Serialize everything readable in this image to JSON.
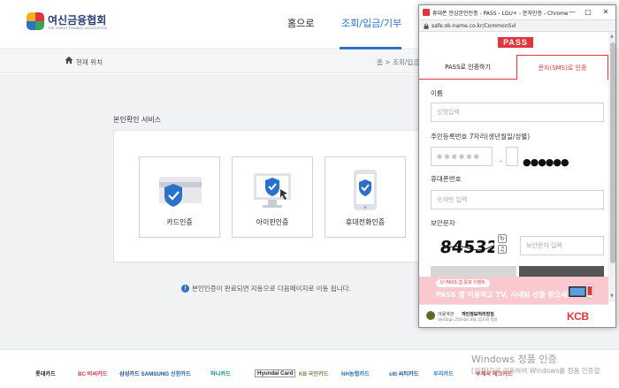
{
  "header": {
    "logo_title": "여신금융협회",
    "logo_subtitle": "THE CREDIT FINANCE ASSOCIATION",
    "nav": [
      "홈으로",
      "조회/입금/기부"
    ]
  },
  "breadcrumb": {
    "current_label": "현재 위치",
    "path": "홈 > 조회/입금"
  },
  "main": {
    "section_title": "본인확인 서비스",
    "cards": [
      {
        "label": "카드인증"
      },
      {
        "label": "아이핀인증"
      },
      {
        "label": "휴대전화인증"
      }
    ],
    "notice_icon": "!",
    "notice": "본인인증이 완료되면 자동으로 다음페이지로 이동 됩니다."
  },
  "footer": {
    "logos": [
      {
        "text": "롯데카드",
        "color": "#222222"
      },
      {
        "text": "BC 비씨카드",
        "color": "#e0353f"
      },
      {
        "text": "삼성카드 SAMSUNG",
        "color": "#1a4ea1"
      },
      {
        "text": "신한카드",
        "color": "#1f5fb3"
      },
      {
        "text": "하나카드",
        "color": "#009689"
      },
      {
        "text": "Hyundai Card",
        "color": "#222222"
      },
      {
        "text": "KB 국민카드",
        "color": "#8a7a4a"
      },
      {
        "text": "NH농협카드",
        "color": "#1f6fc0"
      },
      {
        "text": "citi 씨티카드",
        "color": "#1a4ea1"
      },
      {
        "text": "우리카드",
        "color": "#2a79c9"
      },
      {
        "text": "우체국 체크카드",
        "color": "#e0353f"
      }
    ]
  },
  "popup": {
    "window_title": "휴대폰 안심본인인증 - PASS - LGU+ - 문자인증 - Chrome",
    "url": "safe.ok-name.co.kr/CommonSvl",
    "brand_logo": "PASS",
    "tabs": [
      "PASS로 인증하기",
      "문자(SMS)로 인증"
    ],
    "active_tab": 1,
    "name_label": "이름",
    "name_placeholder": "성명입력",
    "rrn_label": "주민등록번호 7자리(생년월일/성별)",
    "rrn_front_mask": "● ● ● ● ● ●",
    "rrn_separator": "-",
    "rrn_back_mask": "●●●●●●",
    "phone_label": "휴대폰번호",
    "phone_placeholder": "숫자만 입력",
    "captcha_label": "보안문자",
    "captcha_text": "84532",
    "captcha_placeholder": "보안문자 입력",
    "banner_pill": "U⁺PASS 앱 응모 이벤트",
    "banner_headline": "PASS 앱 이용하고 TV, 시네빔 선물 받으세요",
    "footer_terms": "이용약관",
    "footer_privacy": "개인정보처리방침",
    "footer_verisign": "VeriSign 256-bit SSL 암호화 적용",
    "footer_brand": "KCB",
    "accent_color": "#e0353f"
  },
  "watermark": {
    "line1": "Windows 정품 인증",
    "line2": "[설정]으로 이동하여 Windows를 정품 인증합"
  }
}
